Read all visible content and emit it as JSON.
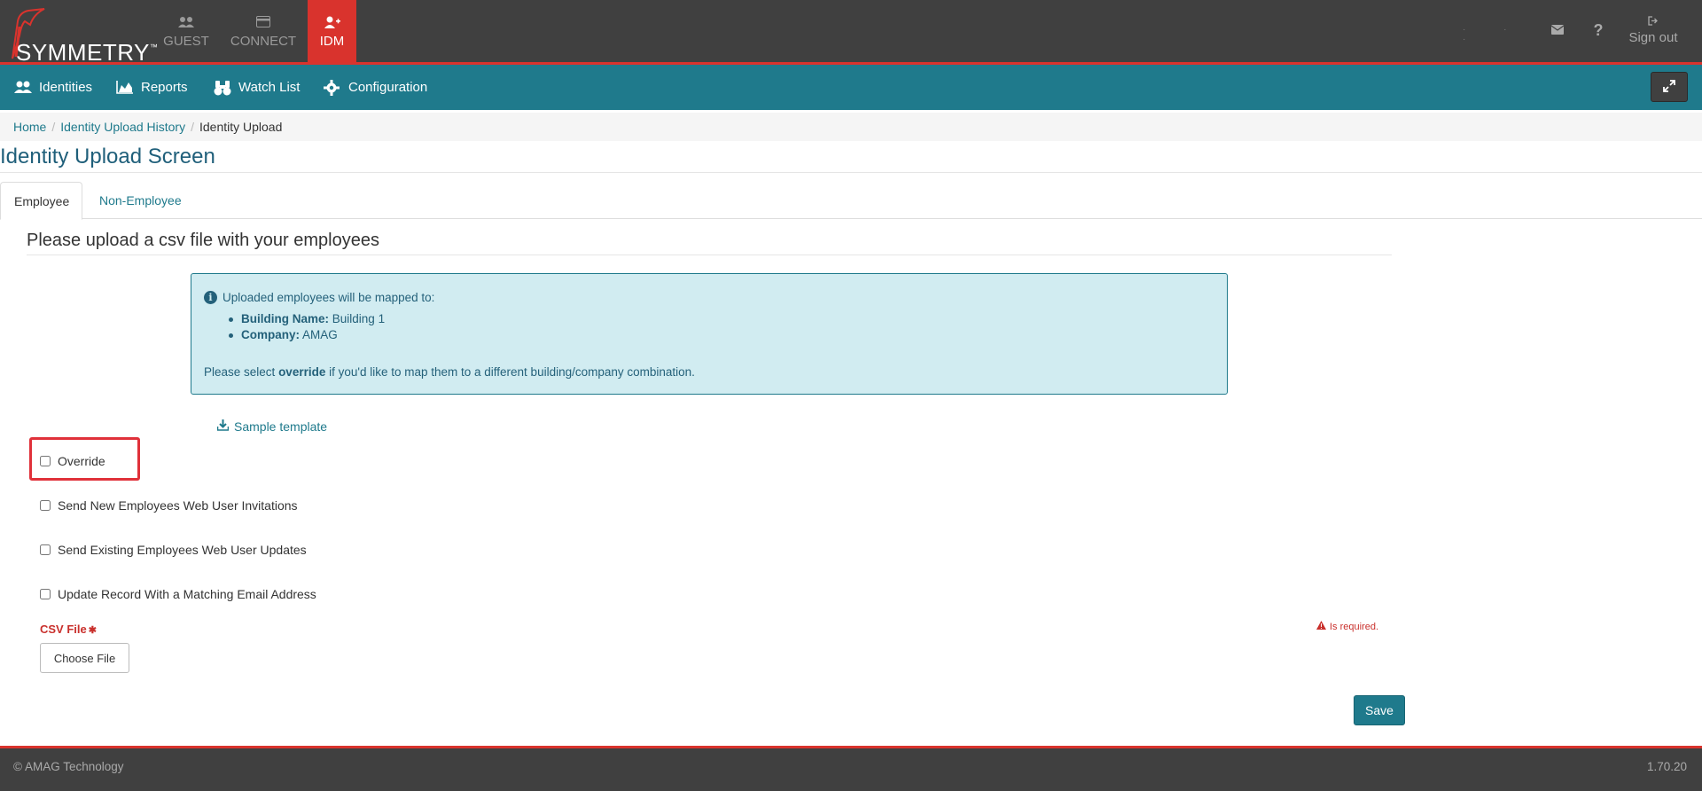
{
  "brand": {
    "logo_text": "SYMMETRY",
    "logo_tm": "™"
  },
  "modules": [
    {
      "label": "GUEST",
      "icon": "users-icon"
    },
    {
      "label": "CONNECT",
      "icon": "card-icon"
    },
    {
      "label": "IDM",
      "icon": "user-plus-icon",
      "active": true
    }
  ],
  "topright": {
    "dots": "· · ·",
    "help": "?",
    "signout": "Sign out"
  },
  "nav": {
    "identities": "Identities",
    "reports": "Reports",
    "watch_list": "Watch List",
    "configuration": "Configuration"
  },
  "breadcrumb": {
    "home": "Home",
    "history": "Identity Upload History",
    "current": "Identity Upload",
    "sep": "/"
  },
  "page": {
    "title": "Identity Upload Screen"
  },
  "tabs": {
    "employee": "Employee",
    "non_employee": "Non-Employee"
  },
  "section": {
    "title": "Please upload a csv file with your employees"
  },
  "info": {
    "intro": "Uploaded employees will be mapped to:",
    "building_label": "Building Name:",
    "building_value": "Building 1",
    "company_label": "Company:",
    "company_value": "AMAG",
    "note_pre": "Please select",
    "note_bold": "override",
    "note_post": "if you'd like to map them to a different building/company combination."
  },
  "sample_template": "Sample template",
  "checkboxes": {
    "override": "Override",
    "send_new": "Send New Employees Web User Invitations",
    "send_existing": "Send Existing Employees Web User Updates",
    "update_email": "Update Record With a Matching Email Address"
  },
  "csv": {
    "label": "CSV File",
    "required_mark": "✱",
    "required_msg": "Is required.",
    "choose_button": "Choose File"
  },
  "save_button": "Save",
  "footer": {
    "copyright": "© AMAG Technology",
    "version": "1.70.20"
  },
  "colors": {
    "header": "#404040",
    "accent_red": "#d9332d",
    "teal": "#1f7a8c",
    "info_bg": "#d1ecf1"
  }
}
